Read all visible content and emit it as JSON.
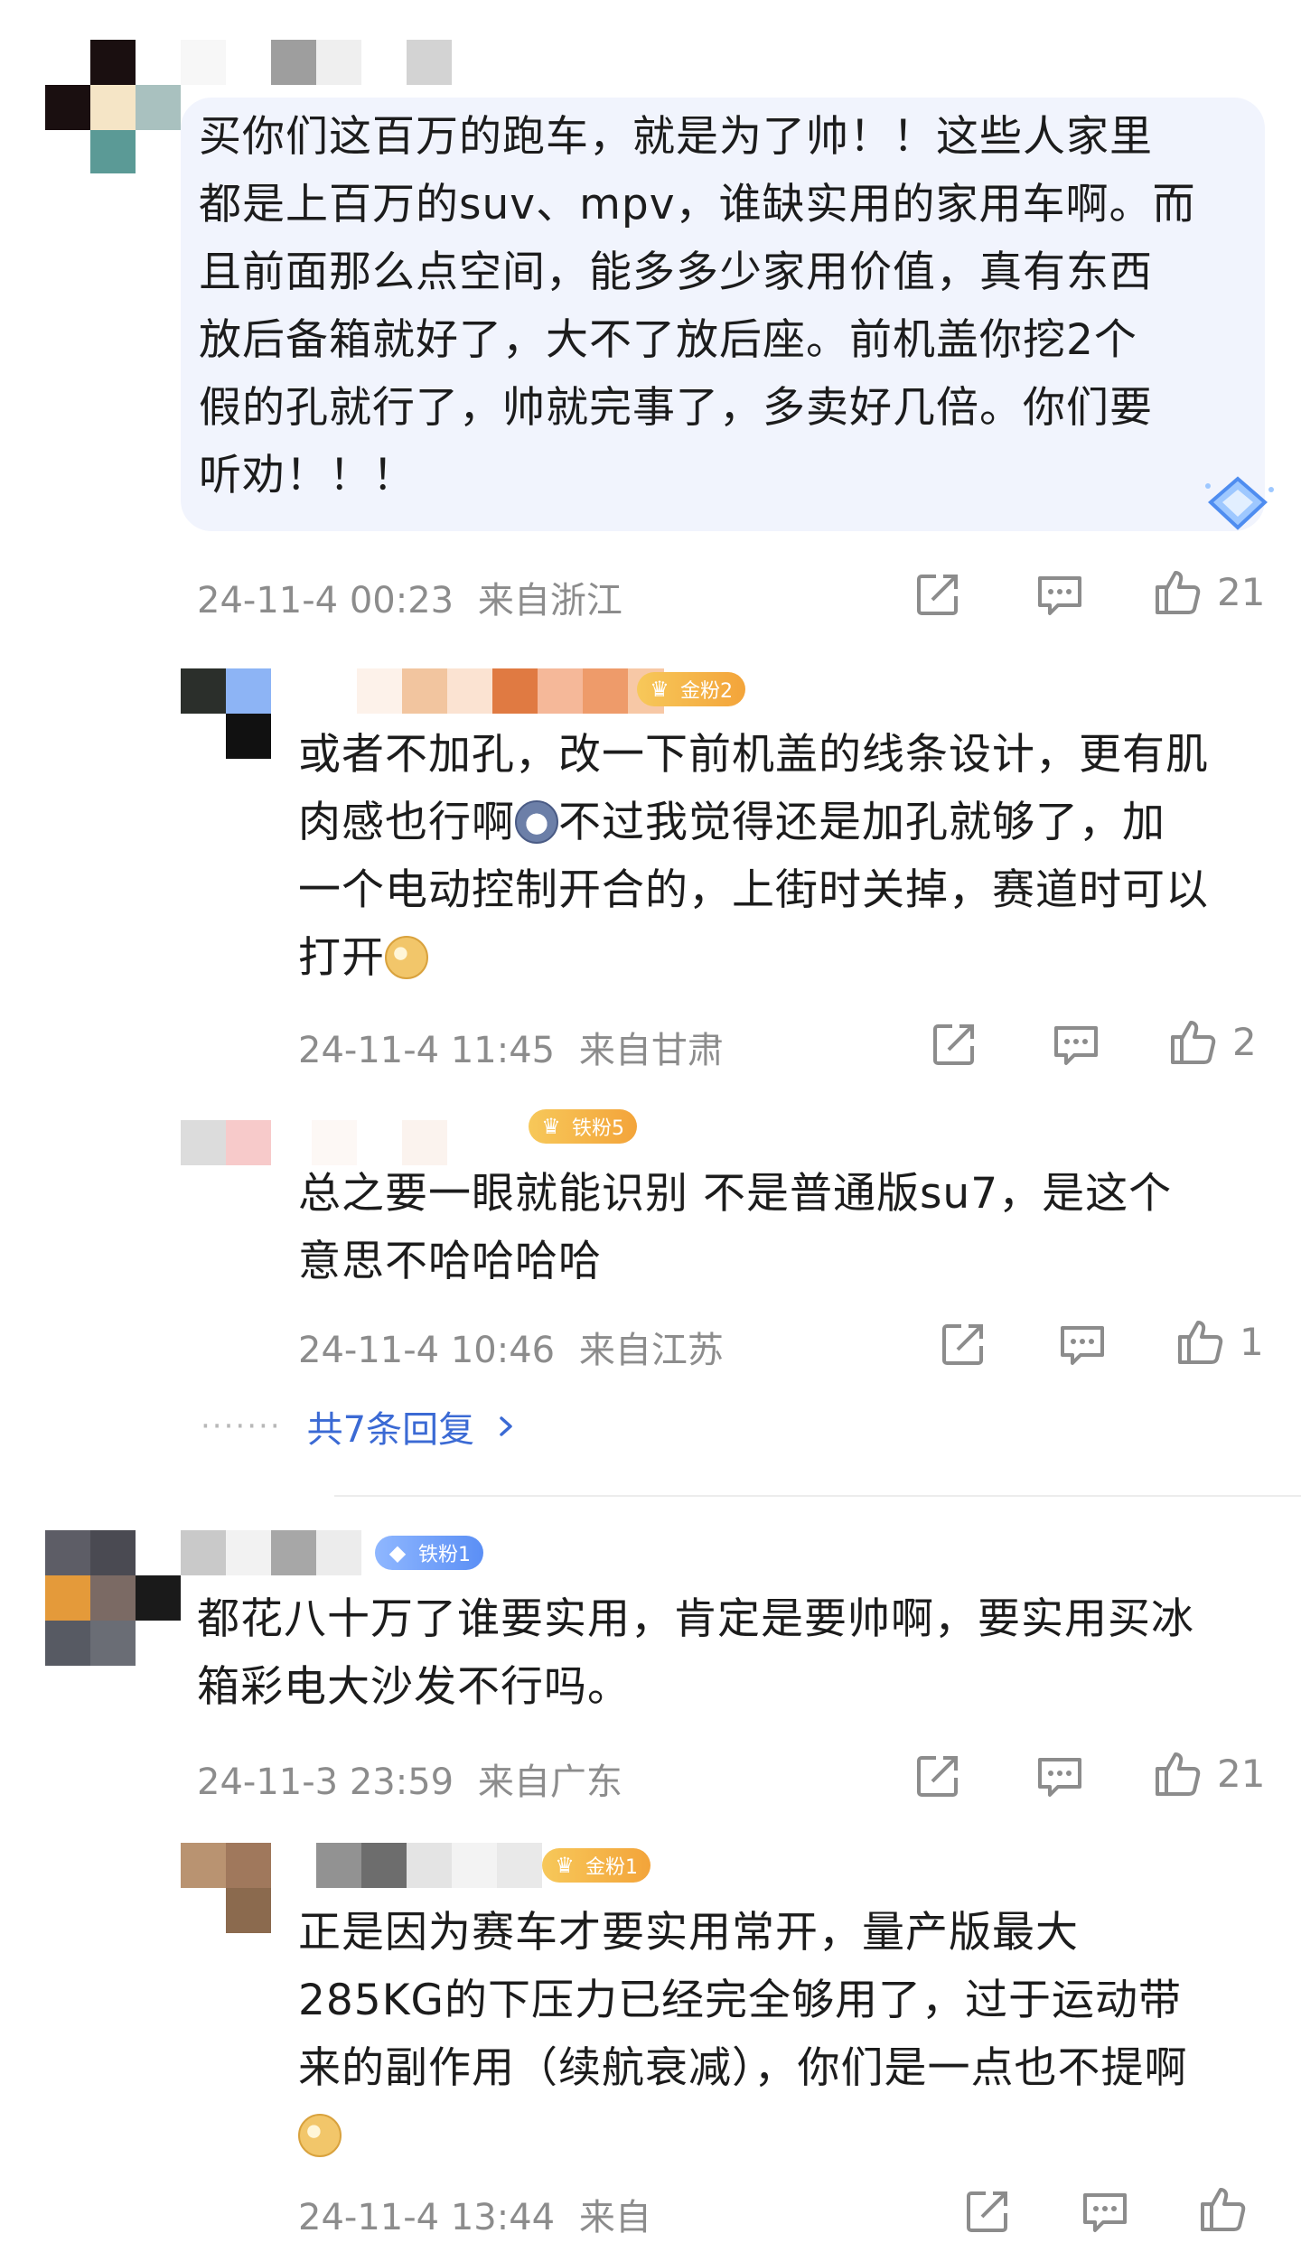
{
  "comments": [
    {
      "text_lines": [
        "买你们这百万的跑车，就是为了帅！！这些人家里",
        "都是上百万的suv、mpv，谁缺实用的家用车啊。而",
        "且前面那么点空间，能多多少家用价值，真有东西",
        "放后备箱就好了，大不了放后座。前机盖你挖2个",
        "假的孔就行了，帅就完事了，多卖好几倍。你们要",
        "听劝！！！"
      ],
      "timestamp": "24-11-4 00:23",
      "location": "来自浙江",
      "likes": "21",
      "replies": [
        {
          "badge": "金粉2",
          "text_lines": [
            "或者不加孔，改一下前机盖的线条设计，更有肌",
            "肉感也行啊",
            "一个电动控制开合的，上街时关掉，赛道时可以",
            "打开"
          ],
          "text_line2_tail": "不过我觉得还是加孔就够了，加",
          "timestamp": "24-11-4 11:45",
          "location": "来自甘肃",
          "likes": "2"
        },
        {
          "badge": "铁粉5",
          "text_lines": [
            "总之要一眼就能识别 不是普通版su7，是这个",
            "意思不哈哈哈哈"
          ],
          "timestamp": "24-11-4 10:46",
          "location": "来自江苏",
          "likes": "1"
        }
      ],
      "more_replies": "共7条回复"
    },
    {
      "badge": "铁粉1",
      "text_lines": [
        "都花八十万了谁要实用，肯定是要帅啊，要实用买冰",
        "箱彩电大沙发不行吗。"
      ],
      "timestamp": "24-11-3 23:59",
      "location": "来自广东",
      "likes": "21",
      "replies": [
        {
          "badge": "金粉1",
          "text_lines": [
            "正是因为赛车才要实用常开，量产版最大",
            "285KG的下压力已经完全够用了，过于运动带",
            "来的副作用（续航衰减），你们是一点也不提啊"
          ],
          "timestamp": "24-11-4 13:44",
          "location": "来自",
          "likes": ""
        }
      ]
    }
  ],
  "colors": {
    "bubble": "#f1f4fd",
    "meta": "#8c8c8c",
    "link": "#3b6ad4",
    "gold_badge": "#f3a43a",
    "iron_badge": "#5b8ff5"
  },
  "icons": [
    "share-icon",
    "comment-icon",
    "thumbs-up-icon",
    "diamond-icon",
    "crown-icon",
    "chevron-right-icon"
  ]
}
